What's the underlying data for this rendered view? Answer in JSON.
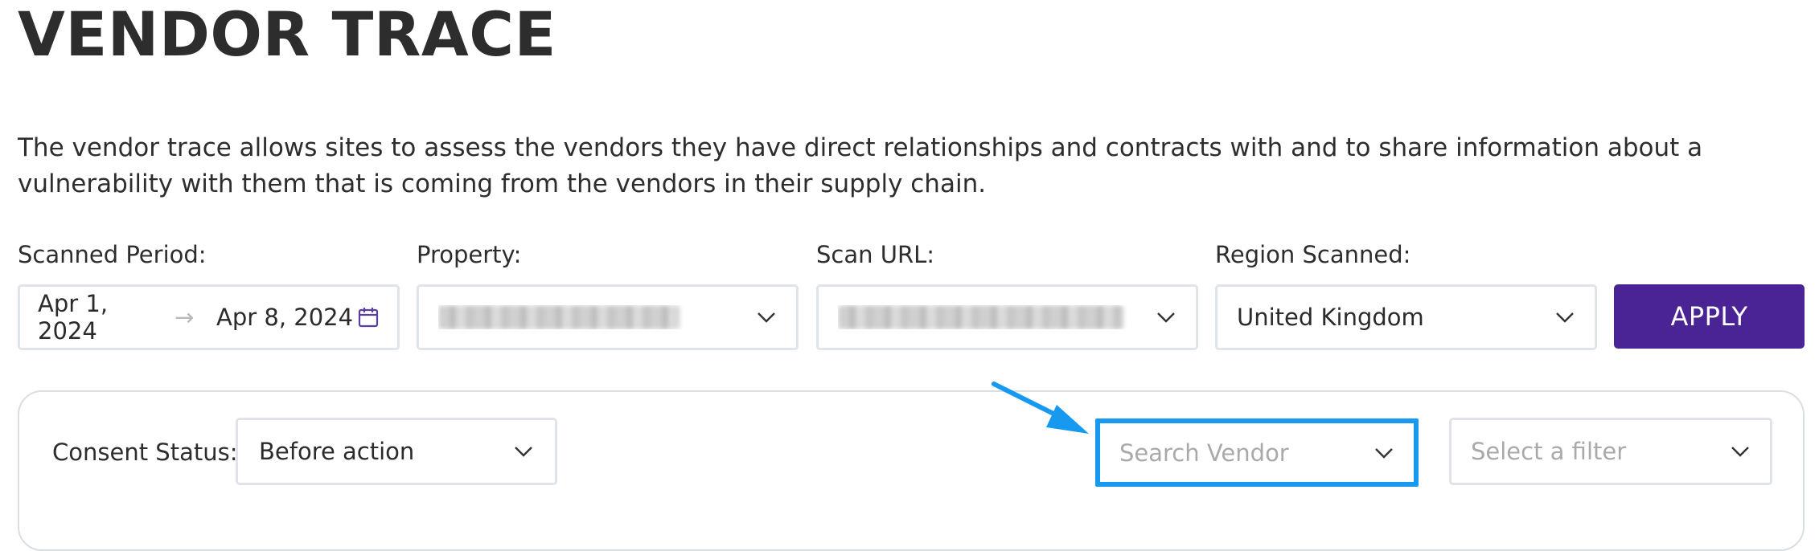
{
  "page": {
    "title": "VENDOR TRACE",
    "description": "The vendor trace allows sites to assess the vendors they have direct relationships and contracts with and to share information about a vulnerability with them that is coming from the vendors in their supply chain."
  },
  "filters": {
    "scanned_period": {
      "label": "Scanned Period:",
      "start": "Apr 1, 2024",
      "separator": "→",
      "end": "Apr 8, 2024"
    },
    "property": {
      "label": "Property:"
    },
    "scan_url": {
      "label": "Scan URL:"
    },
    "region": {
      "label": "Region Scanned:",
      "value": "United Kingdom"
    },
    "apply_label": "APPLY"
  },
  "panel": {
    "consent_status": {
      "label": "Consent Status:",
      "value": "Before action"
    },
    "search_vendor": {
      "placeholder": "Search Vendor"
    },
    "filter_select": {
      "placeholder": "Select a filter"
    }
  },
  "colors": {
    "accent": "#4a2394",
    "highlight": "#1899f0",
    "border": "#dfe4ea"
  },
  "icons": [
    "calendar-icon",
    "chevron-down-icon",
    "arrow-annotation-icon"
  ]
}
